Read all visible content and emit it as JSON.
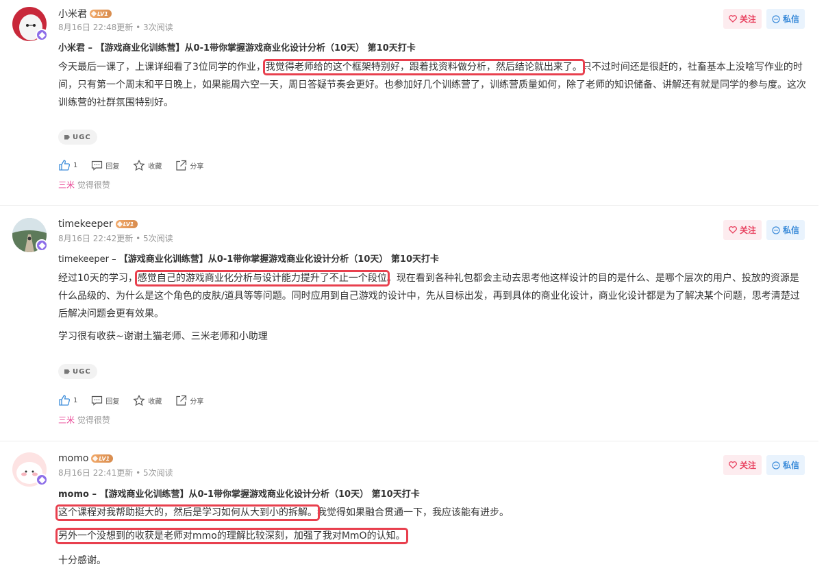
{
  "posts": [
    {
      "user": "小米君",
      "level": "LV1",
      "meta": "8月16日 22:48更新 • 3次阅读",
      "title": "小米君 – 【游戏商业化训练营】从0-1带你掌握游戏商业化设计分析（10天） 第10天打卡",
      "p1_a": "今天最后一课了，上课详细看了3位同学的作业，",
      "p1_hl": "我觉得老师给的这个框架特别好，跟着找资料做分析，然后结论就出来了。",
      "p1_b": "只不过时间还是很赶的，社畜基本上没啥写作业的时间，只有第一个周末和平日晚上，如果能周六空一天，周日答疑节奏会更好。也参加好几个训练营了，训练营质量如何，除了老师的知识储备、讲解还有就是同学的参与度。这次训练营的社群氛围特别好。",
      "tag": "UGC",
      "like_count": "1",
      "reply": "回复",
      "collect": "收藏",
      "share": "分享",
      "liker": "三米",
      "liked_text": "觉得很赞",
      "follow": "关注",
      "message": "私信"
    },
    {
      "user": "timekeeper",
      "level": "LV1",
      "meta": "8月16日 22:42更新 • 5次阅读",
      "title_user": "timekeeper – ",
      "title_rest": "【游戏商业化训练营】从0-1带你掌握游戏商业化设计分析（10天） 第10天打卡",
      "p1_a": "经过10天的学习，",
      "p1_hl": "感觉自己的游戏商业化分析与设计能力提升了不止一个段位",
      "p1_b": "。现在看到各种礼包都会主动去思考他这样设计的目的是什么、是哪个层次的用户、投放的资源是什么品级的、为什么是这个角色的皮肤/道具等等问题。同时应用到自己游戏的设计中，先从目标出发，再到具体的商业化设计，商业化设计都是为了解决某个问题，思考清楚过后解决问题会更有效果。",
      "p2": "学习很有收获~谢谢土猫老师、三米老师和小助理",
      "tag": "UGC",
      "like_count": "1",
      "reply": "回复",
      "collect": "收藏",
      "share": "分享",
      "liker": "三米",
      "liked_text": "觉得很赞",
      "follow": "关注",
      "message": "私信"
    },
    {
      "user": "momo",
      "level": "LV1",
      "meta": "8月16日 22:41更新 • 5次阅读",
      "title": "momo – 【游戏商业化训练营】从0-1带你掌握游戏商业化设计分析（10天） 第10天打卡",
      "p1_hl": "这个课程对我帮助挺大的，然后是学习如何从大到小的拆解。",
      "p1_b": "我觉得如果融合贯通一下，我应该能有进步。",
      "p2_hl": "另外一个没想到的收获是老师对mmo的理解比较深刻，加强了我对MmO的认知。",
      "p3": "十分感谢。",
      "follow": "关注",
      "message": "私信"
    }
  ]
}
